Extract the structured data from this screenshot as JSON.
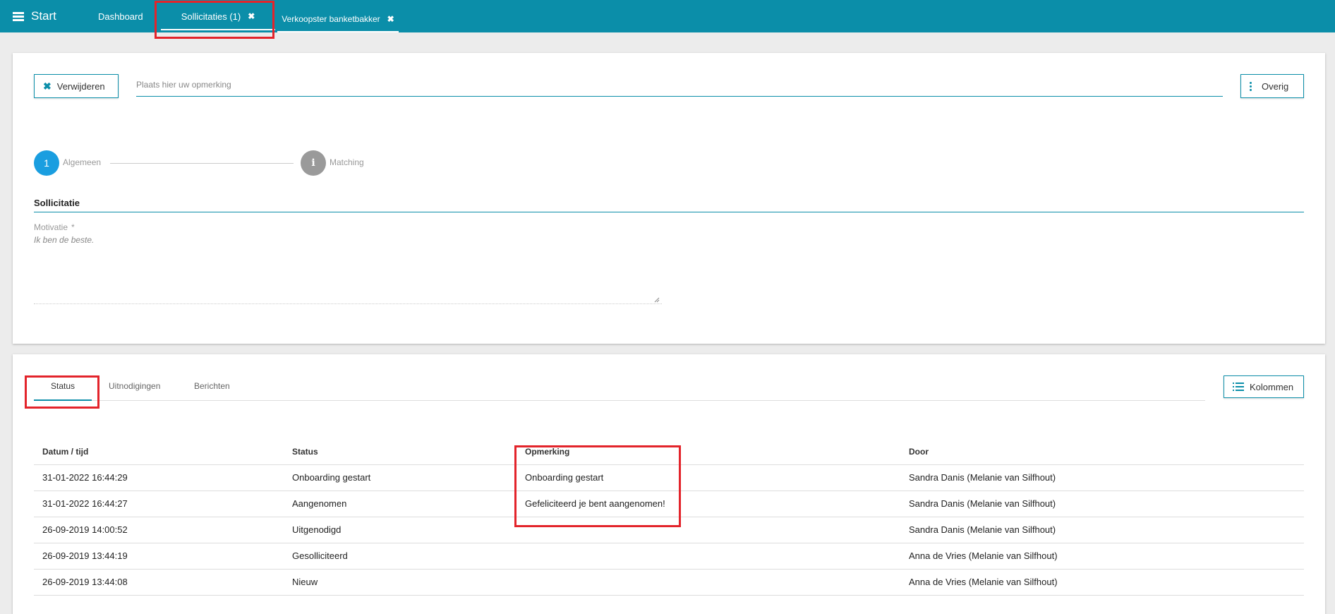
{
  "topbar": {
    "menu_label": "Start",
    "tabs": [
      {
        "label": "Dashboard"
      },
      {
        "label": "Sollicitaties (1)",
        "close": "✖"
      },
      {
        "label": "Verkoopster banketbakker",
        "close": "✖"
      }
    ]
  },
  "toolbar": {
    "delete_label": "Verwijderen",
    "remark_placeholder": "Plaats hier uw opmerking",
    "more_label": "Overig"
  },
  "steps": [
    {
      "number": "1",
      "label": "Algemeen",
      "icon": "number-circle"
    },
    {
      "number": "i",
      "label": "Matching",
      "icon": "info-icon"
    }
  ],
  "form": {
    "section_title": "Sollicitatie",
    "motivation_label": "Motivatie",
    "required_mark": "*",
    "motivation_value": "Ik ben de beste."
  },
  "history": {
    "tabs": [
      "Status",
      "Uitnodigingen",
      "Berichten"
    ],
    "columns_button": "Kolommen",
    "headers": [
      "Datum / tijd",
      "Status",
      "Opmerking",
      "Door"
    ],
    "rows": [
      [
        "31-01-2022 16:44:29",
        "Onboarding gestart",
        "Onboarding gestart",
        "Sandra Danis (Melanie van Silfhout)"
      ],
      [
        "31-01-2022 16:44:27",
        "Aangenomen",
        "Gefeliciteerd je bent aangenomen!",
        "Sandra Danis (Melanie van Silfhout)"
      ],
      [
        "26-09-2019 14:00:52",
        "Uitgenodigd",
        "",
        "Sandra Danis (Melanie van Silfhout)"
      ],
      [
        "26-09-2019 13:44:19",
        "Gesolliciteerd",
        "",
        "Anna de Vries (Melanie van Silfhout)"
      ],
      [
        "26-09-2019 13:44:08",
        "Nieuw",
        "",
        "Anna de Vries (Melanie van Silfhout)"
      ]
    ]
  },
  "colors": {
    "accent": "#0b8ea9",
    "step_active": "#1a9ee0",
    "step_inactive": "#9a9a9a",
    "highlight": "#e3242b"
  }
}
